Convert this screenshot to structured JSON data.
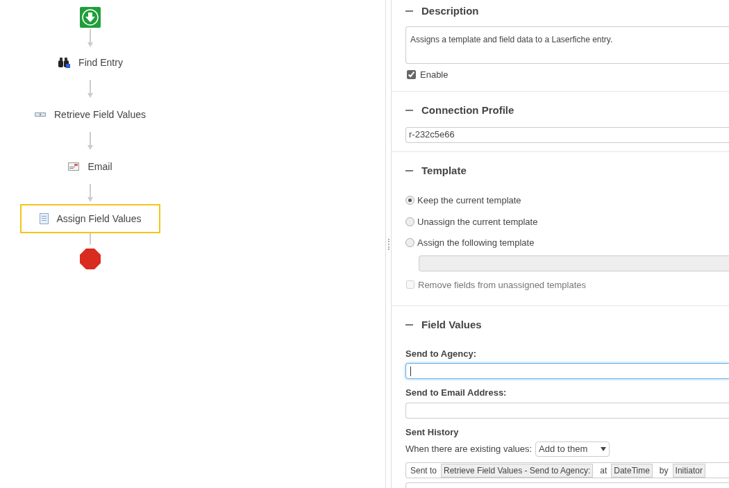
{
  "workflow": {
    "nodes": [
      {
        "kind": "start"
      },
      {
        "kind": "activity",
        "label": "Find Entry",
        "selected": false
      },
      {
        "kind": "activity",
        "label": "Retrieve Field Values",
        "selected": false
      },
      {
        "kind": "activity",
        "label": "Email",
        "selected": false
      },
      {
        "kind": "activity",
        "label": "Assign Field Values",
        "selected": true
      },
      {
        "kind": "end"
      }
    ]
  },
  "properties": {
    "description": {
      "title": "Description",
      "value": "Assigns a template and field data to a Laserfiche entry.",
      "enable": {
        "label": "Enable",
        "checked": true
      }
    },
    "connection_profile": {
      "title": "Connection Profile",
      "value": "r-232c5e66"
    },
    "template": {
      "title": "Template",
      "options": [
        {
          "label": "Keep the current template",
          "selected": true
        },
        {
          "label": "Unassign the current template",
          "selected": false
        },
        {
          "label": "Assign the following template",
          "selected": false
        }
      ],
      "remove_fields": {
        "label": "Remove fields from unassigned templates",
        "checked": false,
        "disabled": true
      }
    },
    "field_values": {
      "title": "Field Values",
      "fields": [
        {
          "label": "Send to Agency:",
          "focused": true
        },
        {
          "label": "Send to Email Address:",
          "focused": false
        }
      ],
      "sent_history": {
        "label": "Sent History",
        "existing_label": "When there are existing values:",
        "existing_choice": "Add to them",
        "parts": [
          {
            "kind": "text",
            "text": "Sent to"
          },
          {
            "kind": "token",
            "text": "Retrieve Field Values - Send to Agency:"
          },
          {
            "kind": "text",
            "text": "at"
          },
          {
            "kind": "token",
            "text": "DateTime"
          },
          {
            "kind": "text",
            "text": "by"
          },
          {
            "kind": "token",
            "text": "Initiator"
          }
        ]
      }
    }
  }
}
